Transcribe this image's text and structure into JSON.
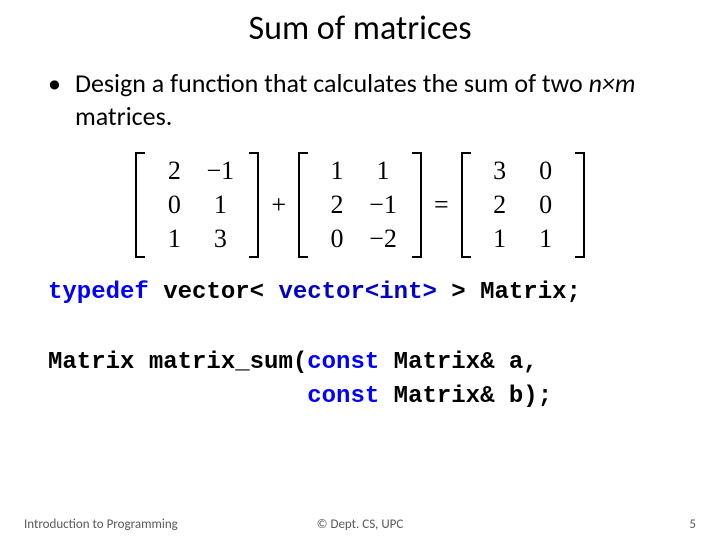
{
  "title": "Sum of matrices",
  "bullet": {
    "prefix": "Design a function that calculates the sum of two ",
    "dims": "n×m",
    "suffix": " matrices."
  },
  "eq": {
    "A": [
      [
        "2",
        "−1"
      ],
      [
        "0",
        "1"
      ],
      [
        "1",
        "3"
      ]
    ],
    "plus": "+",
    "B": [
      [
        "1",
        "1"
      ],
      [
        "2",
        "−1"
      ],
      [
        "0",
        "−2"
      ]
    ],
    "equals": "=",
    "C": [
      [
        "3",
        "0"
      ],
      [
        "2",
        "0"
      ],
      [
        "1",
        "1"
      ]
    ]
  },
  "code": {
    "l1a": "typedef",
    "l1b": " vector< ",
    "l1c": "vector<int>",
    "l1d": " > Matrix;",
    "l2a": "Matrix matrix_sum(",
    "l2b": "const",
    "l2c": " Matrix& a,",
    "l3a": "                  ",
    "l3b": "const",
    "l3c": " Matrix& b);"
  },
  "footer": {
    "left": "Introduction to Programming",
    "center": "© Dept. CS, UPC",
    "right": "5"
  }
}
